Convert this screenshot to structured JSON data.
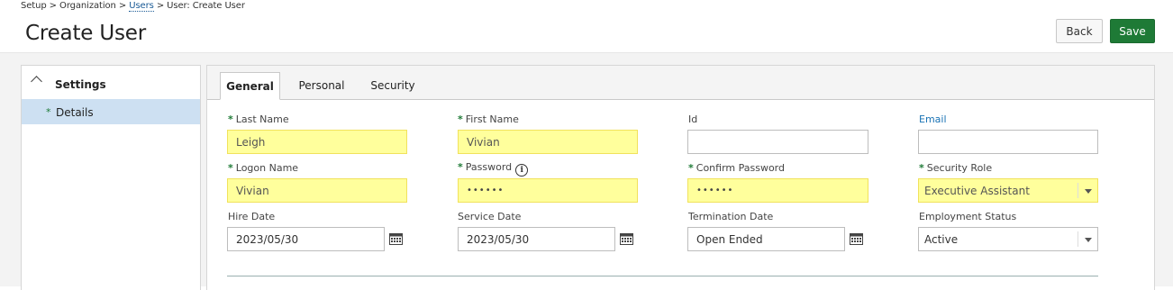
{
  "breadcrumb": {
    "part1": "Setup > Organization > ",
    "link": "Users",
    "part2": " > User: Create User"
  },
  "page_title": "Create User",
  "actions": {
    "back": "Back",
    "save": "Save"
  },
  "sidebar": {
    "section": "Settings",
    "items": [
      {
        "label": "Details",
        "selected": true,
        "required": true
      }
    ]
  },
  "tabs": [
    {
      "label": "General",
      "active": true
    },
    {
      "label": "Personal",
      "active": false
    },
    {
      "label": "Security",
      "active": false
    }
  ],
  "required_marker": "*",
  "fields": {
    "last_name": {
      "label": "Last Name",
      "value": "Leigh"
    },
    "first_name": {
      "label": "First Name",
      "value": "Vivian"
    },
    "id": {
      "label": "Id",
      "value": ""
    },
    "email": {
      "label": "Email",
      "value": ""
    },
    "logon_name": {
      "label": "Logon Name",
      "value": "Vivian"
    },
    "password": {
      "label": "Password",
      "value": "••••••"
    },
    "confirm_password": {
      "label": "Confirm Password",
      "value": "••••••"
    },
    "security_role": {
      "label": "Security Role",
      "value": "Executive Assistant"
    },
    "hire_date": {
      "label": "Hire Date",
      "value": "2023/05/30"
    },
    "service_date": {
      "label": "Service Date",
      "value": "2023/05/30"
    },
    "termination_date": {
      "label": "Termination Date",
      "value": "Open Ended"
    },
    "employment_status": {
      "label": "Employment Status",
      "value": "Active"
    }
  },
  "colors": {
    "required_highlight": "#ffff9c",
    "primary_button": "#1e7a36",
    "link": "#1a73b5",
    "selected_nav": "#cde0f2"
  }
}
